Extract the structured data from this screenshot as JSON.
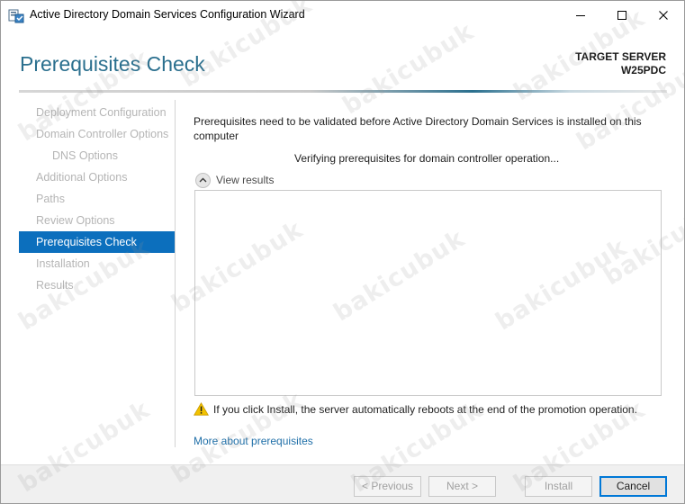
{
  "window": {
    "title": "Active Directory Domain Services Configuration Wizard"
  },
  "header": {
    "page_title": "Prerequisites Check",
    "target_label": "TARGET SERVER",
    "target_name": "W25PDC"
  },
  "nav": {
    "items": [
      {
        "label": "Deployment Configuration",
        "state": "disabled"
      },
      {
        "label": "Domain Controller Options",
        "state": "disabled"
      },
      {
        "label": "DNS Options",
        "state": "disabled"
      },
      {
        "label": "Additional Options",
        "state": "disabled"
      },
      {
        "label": "Paths",
        "state": "disabled"
      },
      {
        "label": "Review Options",
        "state": "disabled"
      },
      {
        "label": "Prerequisites Check",
        "state": "active"
      },
      {
        "label": "Installation",
        "state": "disabled"
      },
      {
        "label": "Results",
        "state": "disabled"
      }
    ]
  },
  "content": {
    "description": "Prerequisites need to be validated before Active Directory Domain Services is installed on this computer",
    "verifying": "Verifying prerequisites for domain controller operation...",
    "view_results": "View results",
    "warning": "If you click Install, the server automatically reboots at the end of the promotion operation.",
    "more_link": "More about prerequisites"
  },
  "footer": {
    "previous": "< Previous",
    "next": "Next >",
    "install": "Install",
    "cancel": "Cancel"
  },
  "watermark": {
    "text": "bakicubuk"
  },
  "colors": {
    "title_blue": "#2a6f8e",
    "nav_active_bg": "#0c6fbd",
    "link": "#1f6fa8",
    "warning": "#f2c200"
  }
}
